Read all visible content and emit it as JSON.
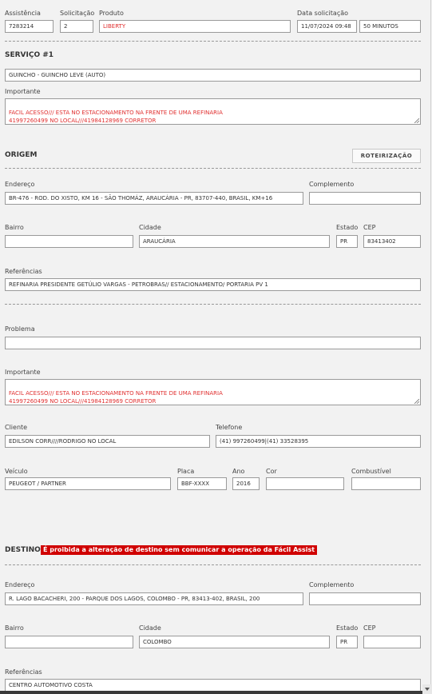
{
  "header": {
    "assistencia_label": "Assistência",
    "assistencia_value": "7283214",
    "solicitacao_label": "Solicitação",
    "solicitacao_value": "2",
    "produto_label": "Produto",
    "produto_value": "LIBERTY",
    "data_label": "Data solicitação",
    "data_value": "11/07/2024 09:48",
    "tempo_value": "50 MINUTOS"
  },
  "servico": {
    "title": "SERVIÇO #1",
    "tipo_value": "GUINCHO - GUINCHO LEVE (AUTO)",
    "importante_label": "Importante",
    "importante_value": "FACIL ACESSO/// ESTA NO ESTACIONAMENTO NA FRENTE DE UMA REFINARIA\n41997260499 NO LOCAL///41984128969 CORRETOR"
  },
  "origem": {
    "title": "ORIGEM",
    "route_button": "ROTEIRIZAÇÃO",
    "endereco_label": "Endereço",
    "endereco_value": "BR-476 - ROD. DO XISTO, KM 16 - SÃO THOMÁZ, ARAUCÁRIA - PR, 83707-440, BRASIL, KM+16",
    "complemento_label": "Complemento",
    "complemento_value": "",
    "bairro_label": "Bairro",
    "bairro_value": "",
    "cidade_label": "Cidade",
    "cidade_value": "ARAUCÁRIA",
    "estado_label": "Estado",
    "estado_value": "PR",
    "cep_label": "CEP",
    "cep_value": "83413402",
    "referencias_label": "Referências",
    "referencias_value": "REFINARIA PRESIDENTE GETÚLIO VARGAS - PETROBRAS// ESTACIONAMENTO/ PORTARIA PV 1"
  },
  "problema": {
    "label": "Problema",
    "value": "",
    "importante_label": "Importante",
    "importante_value": "FACIL ACESSO/// ESTA NO ESTACIONAMENTO NA FRENTE DE UMA REFINARIA\n41997260499 NO LOCAL///41984128969 CORRETOR"
  },
  "cliente": {
    "cliente_label": "Cliente",
    "cliente_value": "EDILSON CORR////RODRIGO NO LOCAL",
    "telefone_label": "Telefone",
    "telefone_value": "(41) 997260499|(41) 33528395"
  },
  "veiculo": {
    "veiculo_label": "Veículo",
    "veiculo_value": "PEUGEOT / PARTNER",
    "placa_label": "Placa",
    "placa_value": "BBF-XXXX",
    "ano_label": "Ano",
    "ano_value": "2016",
    "cor_label": "Cor",
    "cor_value": "",
    "combustivel_label": "Combustível",
    "combustivel_value": ""
  },
  "destino": {
    "title": "DESTINO",
    "warning": "É proibida a alteração de destino sem comunicar a operação da Fácil Assist",
    "endereco_label": "Endereço",
    "endereco_value": "R. LAGO BACACHERI, 200 - PARQUE DOS LAGOS, COLOMBO - PR, 83413-402, BRASIL, 200",
    "complemento_label": "Complemento",
    "complemento_value": "",
    "bairro_label": "Bairro",
    "bairro_value": "",
    "cidade_label": "Cidade",
    "cidade_value": "COLOMBO",
    "estado_label": "Estado",
    "estado_value": "PR",
    "cep_label": "CEP",
    "cep_value": "",
    "referencias_label": "Referências",
    "referencias_value": "CENTRO AUTOMOTIVO COSTA"
  },
  "colors": {
    "warning_bg": "#d00000",
    "highlight_text": "#e03030",
    "border": "#9a9a9a"
  }
}
